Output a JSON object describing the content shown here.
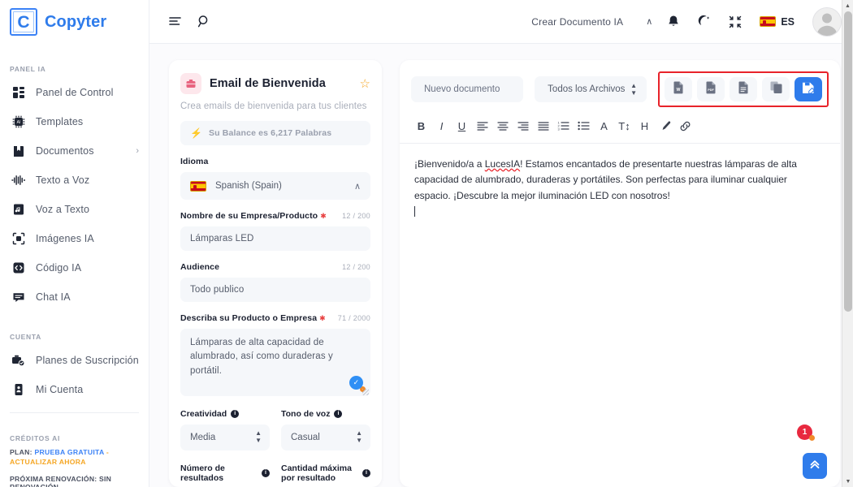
{
  "brand": {
    "mark": "C",
    "name": "Copyter"
  },
  "sidebar": {
    "section_panel": "PANEL IA",
    "items": [
      {
        "label": "Panel de Control",
        "icon": "dashboard-icon"
      },
      {
        "label": "Templates",
        "icon": "chip-ai-icon"
      },
      {
        "label": "Documentos",
        "icon": "book-icon",
        "caret": "›"
      },
      {
        "label": "Texto a Voz",
        "icon": "waveform-icon"
      },
      {
        "label": "Voz a Texto",
        "icon": "audio-file-icon"
      },
      {
        "label": "Imágenes IA",
        "icon": "image-ai-icon"
      },
      {
        "label": "Código IA",
        "icon": "code-icon"
      },
      {
        "label": "Chat IA",
        "icon": "chat-icon"
      }
    ],
    "section_account": "CUENTA",
    "account_items": [
      {
        "label": "Planes de Suscripción",
        "icon": "subscription-icon"
      },
      {
        "label": "Mi Cuenta",
        "icon": "id-card-icon"
      }
    ],
    "section_credits": "CRÉDITOS AI",
    "plan_prefix": "PLAN:",
    "plan_value": "PRUEBA GRATUITA",
    "plan_sep": "-",
    "plan_upgrade": "ACTUALIZAR AHORA",
    "renewal": "PRÓXIMA RENOVACIÓN: SIN RENOVACIÓN"
  },
  "topbar": {
    "menu_icon": "list-menu-icon",
    "search_icon": "search-icon",
    "create_doc": "Crear Documento IA",
    "create_caret": "∧",
    "bell_icon": "bell-icon",
    "theme_icon": "moon-star-icon",
    "fullscreen_icon": "collapse-icon",
    "lang_code": "ES",
    "avatar": "user-avatar"
  },
  "form": {
    "template_icon": "briefcase-icon",
    "title": "Email de Bienvenida",
    "star": "☆",
    "subtitle": "Crea emails de bienvenida para tus clientes",
    "balance_bolt": "⚡",
    "balance": "Su Balance es 6,217 Palabras",
    "language_label": "Idioma",
    "language_value": "Spanish (Spain)",
    "language_caret": "∧",
    "fields": [
      {
        "label": "Nombre de su Empresa/Producto",
        "required": true,
        "count": "12 / 200",
        "value": "Lámparas LED",
        "type": "input"
      },
      {
        "label": "Audience",
        "required": false,
        "count": "12 / 200",
        "value": "Todo publico",
        "type": "input"
      },
      {
        "label": "Describa su Producto o Empresa",
        "required": true,
        "count": "71 / 2000",
        "value": "Lámparas de alta capacidad de alumbrado, así como duraderas y portátil.",
        "type": "textarea"
      }
    ],
    "creativity_label": "Creatividad",
    "creativity_value": "Media",
    "tone_label": "Tono de voz",
    "tone_value": "Casual",
    "results_label": "Número de resultados",
    "max_per_result_label": "Cantidad máxima por resultado",
    "info_glyph": "i"
  },
  "editor": {
    "new_doc_placeholder": "Nuevo documento",
    "filter_value": "Todos los Archivos",
    "export_buttons": [
      {
        "icon": "word-doc-icon",
        "label": "W"
      },
      {
        "icon": "pdf-doc-icon",
        "label": "PDF"
      },
      {
        "icon": "text-doc-icon",
        "label": ""
      },
      {
        "icon": "copy-icon",
        "label": ""
      },
      {
        "icon": "save-doc-icon",
        "label": "",
        "primary": true
      }
    ],
    "toolbar": [
      {
        "name": "bold-button",
        "glyph": "B"
      },
      {
        "name": "italic-button",
        "glyph": "I"
      },
      {
        "name": "underline-button",
        "glyph": "U"
      },
      {
        "name": "align-left-button",
        "glyph": ""
      },
      {
        "name": "align-center-button",
        "glyph": ""
      },
      {
        "name": "align-right-button",
        "glyph": ""
      },
      {
        "name": "align-justify-button",
        "glyph": ""
      },
      {
        "name": "ordered-list-button",
        "glyph": ""
      },
      {
        "name": "unordered-list-button",
        "glyph": ""
      },
      {
        "name": "font-color-button",
        "glyph": "A"
      },
      {
        "name": "font-size-button",
        "glyph": "T↕"
      },
      {
        "name": "heading-button",
        "glyph": "H"
      },
      {
        "name": "brush-button",
        "glyph": ""
      },
      {
        "name": "link-button",
        "glyph": ""
      }
    ],
    "content_part1": "¡Bienvenido/a a ",
    "content_misspell": "LucesIA",
    "content_part2": "! Estamos encantados de presentarte nuestras lámparas de alta capacidad de alumbrado, duraderas y portátiles. Son perfectas para iluminar cualquier espacio. ¡Descubre la mejor iluminación LED con nosotros!"
  },
  "floating": {
    "notification_count": "1",
    "scroll_top_icon": "double-chevron-up-icon"
  },
  "colors": {
    "brand_blue": "#2f7ceb",
    "accent_orange": "#f5a623",
    "danger_red": "#e8232a",
    "panel_bg": "#fbfbfd"
  }
}
